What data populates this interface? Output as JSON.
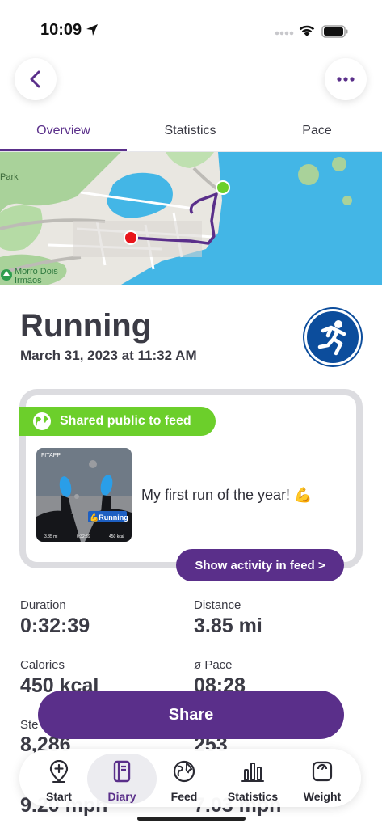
{
  "status_bar": {
    "time": "10:09"
  },
  "tabs": [
    {
      "label": "Overview",
      "active": true
    },
    {
      "label": "Statistics",
      "active": false
    },
    {
      "label": "Pace",
      "active": false
    }
  ],
  "map": {
    "labels": [
      "Park",
      "Morro Dois",
      "Irmãos"
    ],
    "start_color": "#6ccf2b",
    "end_color": "#e8141a"
  },
  "activity": {
    "title": "Running",
    "date": "March 31, 2023 at 11:32 AM"
  },
  "shared_card": {
    "badge": "Shared public to feed",
    "post_text": "My first run of the year! 💪",
    "thumb_brand": "FITAPP",
    "thumb_tag": "💪Running",
    "thumb_stats": [
      "3.85 mi",
      "0:32:39",
      "450 kcal"
    ],
    "feed_button": "Show activity in feed >"
  },
  "stats": {
    "duration": {
      "label": "Duration",
      "value": "0:32:39"
    },
    "distance": {
      "label": "Distance",
      "value": "3.85 mi"
    },
    "calories": {
      "label": "Calories",
      "value": "450 kcal"
    },
    "pace": {
      "label": "ø Pace",
      "value": "08:28"
    },
    "steps": {
      "label": "Ste",
      "value": "8,286"
    },
    "cadence": {
      "value": "253"
    },
    "speed": {
      "value": "9.20 mph"
    },
    "max_speed": {
      "value": "7.03 mph"
    }
  },
  "share_button": "Share",
  "bottom_nav": [
    {
      "label": "Start",
      "icon": "location-pin-plus-icon"
    },
    {
      "label": "Diary",
      "icon": "diary-book-icon",
      "active": true
    },
    {
      "label": "Feed",
      "icon": "globe-icon"
    },
    {
      "label": "Statistics",
      "icon": "bar-chart-icon"
    },
    {
      "label": "Weight",
      "icon": "scale-icon"
    }
  ],
  "colors": {
    "accent": "#5a2f8a",
    "green": "#6ccf2b",
    "sport_blue": "#0c4d9c"
  }
}
